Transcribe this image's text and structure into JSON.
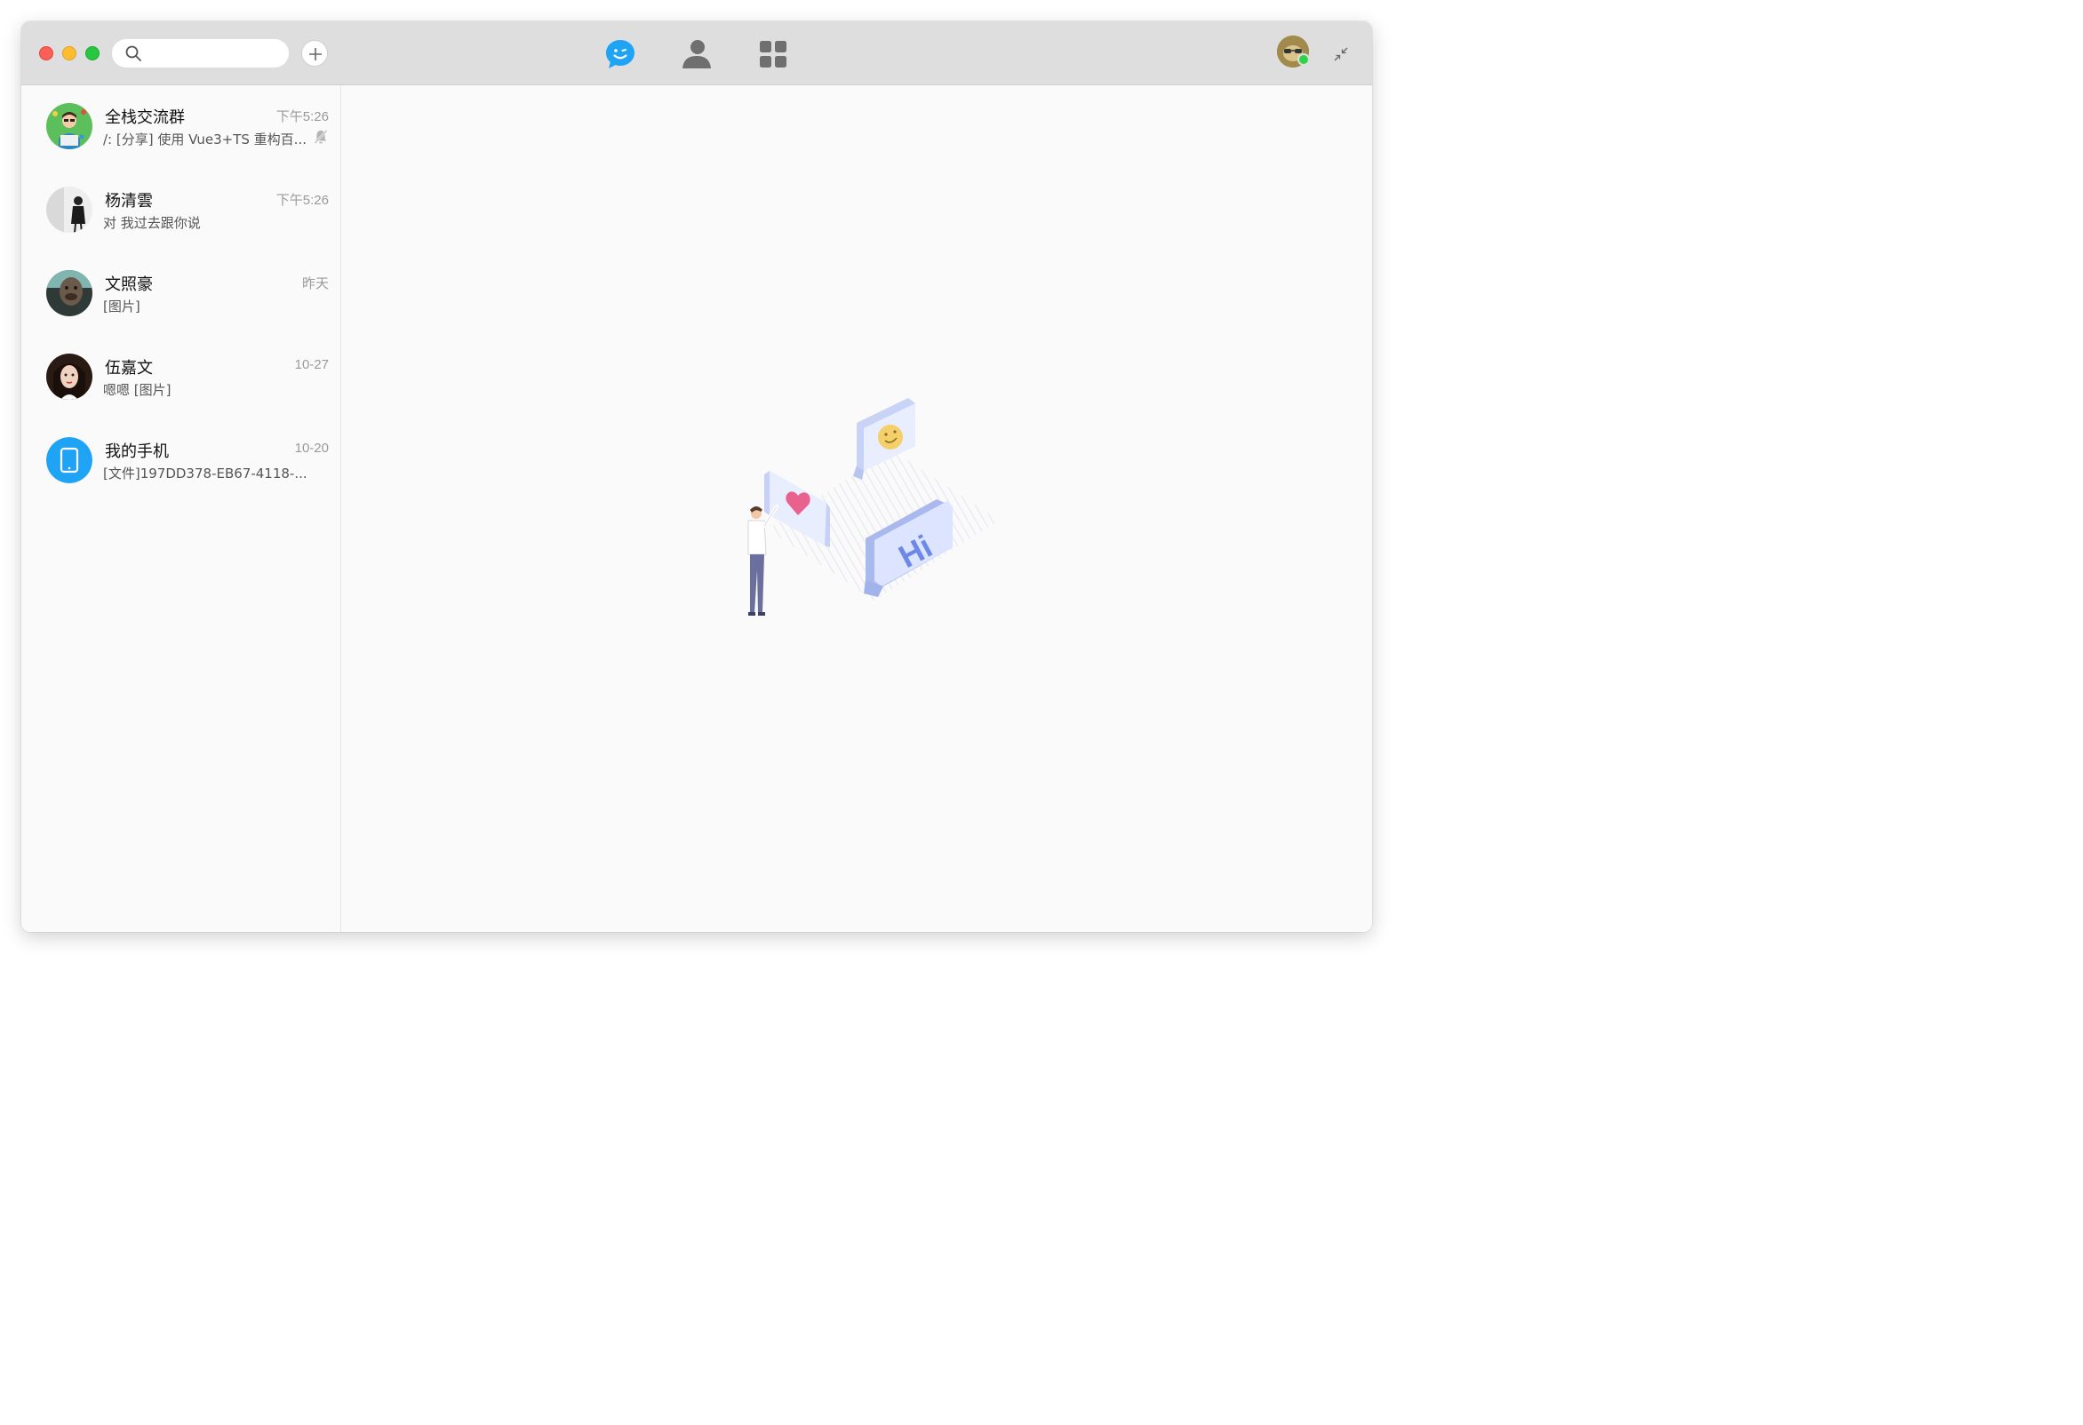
{
  "window": {
    "controls": [
      "close",
      "minimize",
      "maximize"
    ]
  },
  "toolbar": {
    "search": {
      "value": "",
      "placeholder": "",
      "icon": "search-icon"
    },
    "add_button_icon": "plus-icon",
    "nav": [
      {
        "id": "chat",
        "icon": "chat-bubble-icon",
        "active": true,
        "color": "#1fa3f5"
      },
      {
        "id": "contacts",
        "icon": "person-icon",
        "active": false,
        "color": "#707070"
      },
      {
        "id": "apps",
        "icon": "grid-icon",
        "active": false,
        "color": "#707070"
      }
    ],
    "user_status": "online",
    "shrink_icon": "shrink-window-icon"
  },
  "conversations": [
    {
      "name": "全栈交流群",
      "time": "下午5:26",
      "preview": "/: [分享] 使用 Vue3+TS 重构百...",
      "muted": true
    },
    {
      "name": "杨清雲",
      "time": "下午5:26",
      "preview": "对 我过去跟你说",
      "muted": false
    },
    {
      "name": "文照豪",
      "time": "昨天",
      "preview": "[图片]",
      "muted": false
    },
    {
      "name": "伍嘉文",
      "time": "10-27",
      "preview": "嗯嗯 [图片]",
      "muted": false
    },
    {
      "name": "我的手机",
      "time": "10-20",
      "preview": "[文件]197DD378-EB67-4118-...",
      "muted": false
    }
  ],
  "colors": {
    "accent": "#1fa3f5",
    "titlebar": "#dededf",
    "background": "#fafafa"
  }
}
